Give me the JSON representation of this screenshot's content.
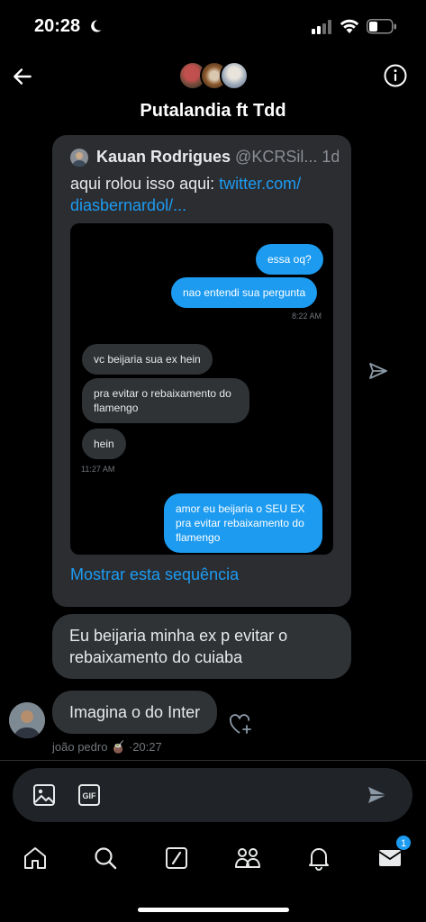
{
  "status_bar": {
    "time": "20:28",
    "icons": [
      "moon-icon",
      "signal-icon",
      "wifi-icon",
      "battery-icon"
    ]
  },
  "header": {
    "title": "Putalandia ft Tdd",
    "icons": [
      "back-arrow-icon",
      "info-icon"
    ]
  },
  "quoted_tweet": {
    "author_name": "Kauan Rodrigues",
    "author_handle": "@KCRSil...",
    "age": "1d",
    "text": "aqui rolou isso aqui: ",
    "link_text": "twitter.com/ diasbernardol/...",
    "show_thread": "Mostrar esta sequência",
    "screenshot": {
      "messages": [
        {
          "dir": "out",
          "text": "essa oq?"
        },
        {
          "dir": "out",
          "text": "nao entendi sua pergunta"
        },
        {
          "dir": "in",
          "text": "vc beijaria sua ex hein"
        },
        {
          "dir": "in",
          "text": "pra evitar o rebaixamento do flamengo"
        },
        {
          "dir": "in",
          "text": "hein"
        },
        {
          "dir": "out",
          "text": "amor eu beijaria o SEU EX pra evitar rebaixamento do flamengo"
        }
      ],
      "time_out": "8:22 AM",
      "time_in": "11:27 AM"
    }
  },
  "messages": [
    {
      "text": "Eu beijaria minha ex p evitar o rebaixamento do cuiaba"
    },
    {
      "text": "Imagina o do Inter"
    }
  ],
  "message_meta": {
    "sender": "joão pedro 🧉",
    "time": "·20:27"
  },
  "composer": {
    "placeholder": "",
    "gif_label": "GIF"
  },
  "tabbar": {
    "items": [
      "home",
      "search",
      "grok",
      "communities",
      "notifications",
      "messages"
    ],
    "messages_badge": "1"
  },
  "colors": {
    "accent": "#1d9bf0",
    "background": "#000000",
    "card": "#2b2d31",
    "bubble": "#2f3336"
  }
}
